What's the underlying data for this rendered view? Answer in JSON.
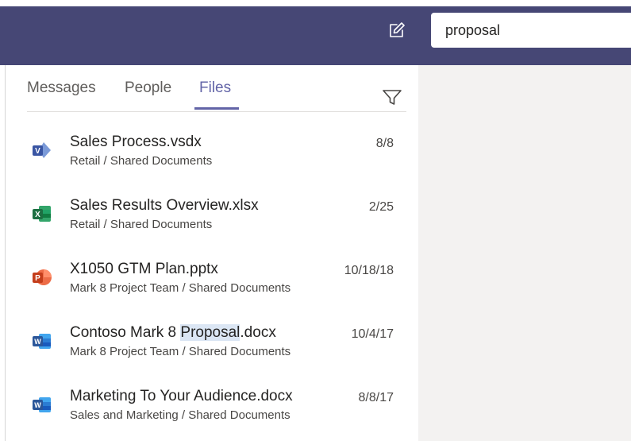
{
  "search": {
    "value": "proposal",
    "placeholder": ""
  },
  "tabs": [
    {
      "label": "Messages",
      "active": false
    },
    {
      "label": "People",
      "active": false
    },
    {
      "label": "Files",
      "active": true
    }
  ],
  "files": [
    {
      "icon": "visio-icon",
      "name": "Sales Process.vsdx",
      "path": "Retail / Shared Documents",
      "date": "8/8"
    },
    {
      "icon": "excel-icon",
      "name": "Sales Results Overview.xlsx",
      "path": "Retail / Shared Documents",
      "date": "2/25"
    },
    {
      "icon": "powerpoint-icon",
      "name": "X1050 GTM Plan.pptx",
      "path": "Mark 8 Project Team / Shared Documents",
      "date": "10/18/18"
    },
    {
      "icon": "word-icon",
      "name_before": "Contoso Mark 8 ",
      "name_highlight": "Proposal",
      "name_after": ".docx",
      "path": "Mark 8 Project Team / Shared Documents",
      "date": "10/4/17"
    },
    {
      "icon": "word-icon",
      "name": "Marketing To Your Audience.docx",
      "path": "Sales and Marketing / Shared Documents",
      "date": "8/8/17"
    }
  ],
  "colors": {
    "header": "#464775",
    "accent": "#6264a7",
    "right_pane": "#f3f2f1",
    "highlight": "#dbe6f4",
    "visio": "#3955a3",
    "excel": "#1d6f42",
    "powerpoint": "#d24726",
    "word": "#2b579a"
  }
}
